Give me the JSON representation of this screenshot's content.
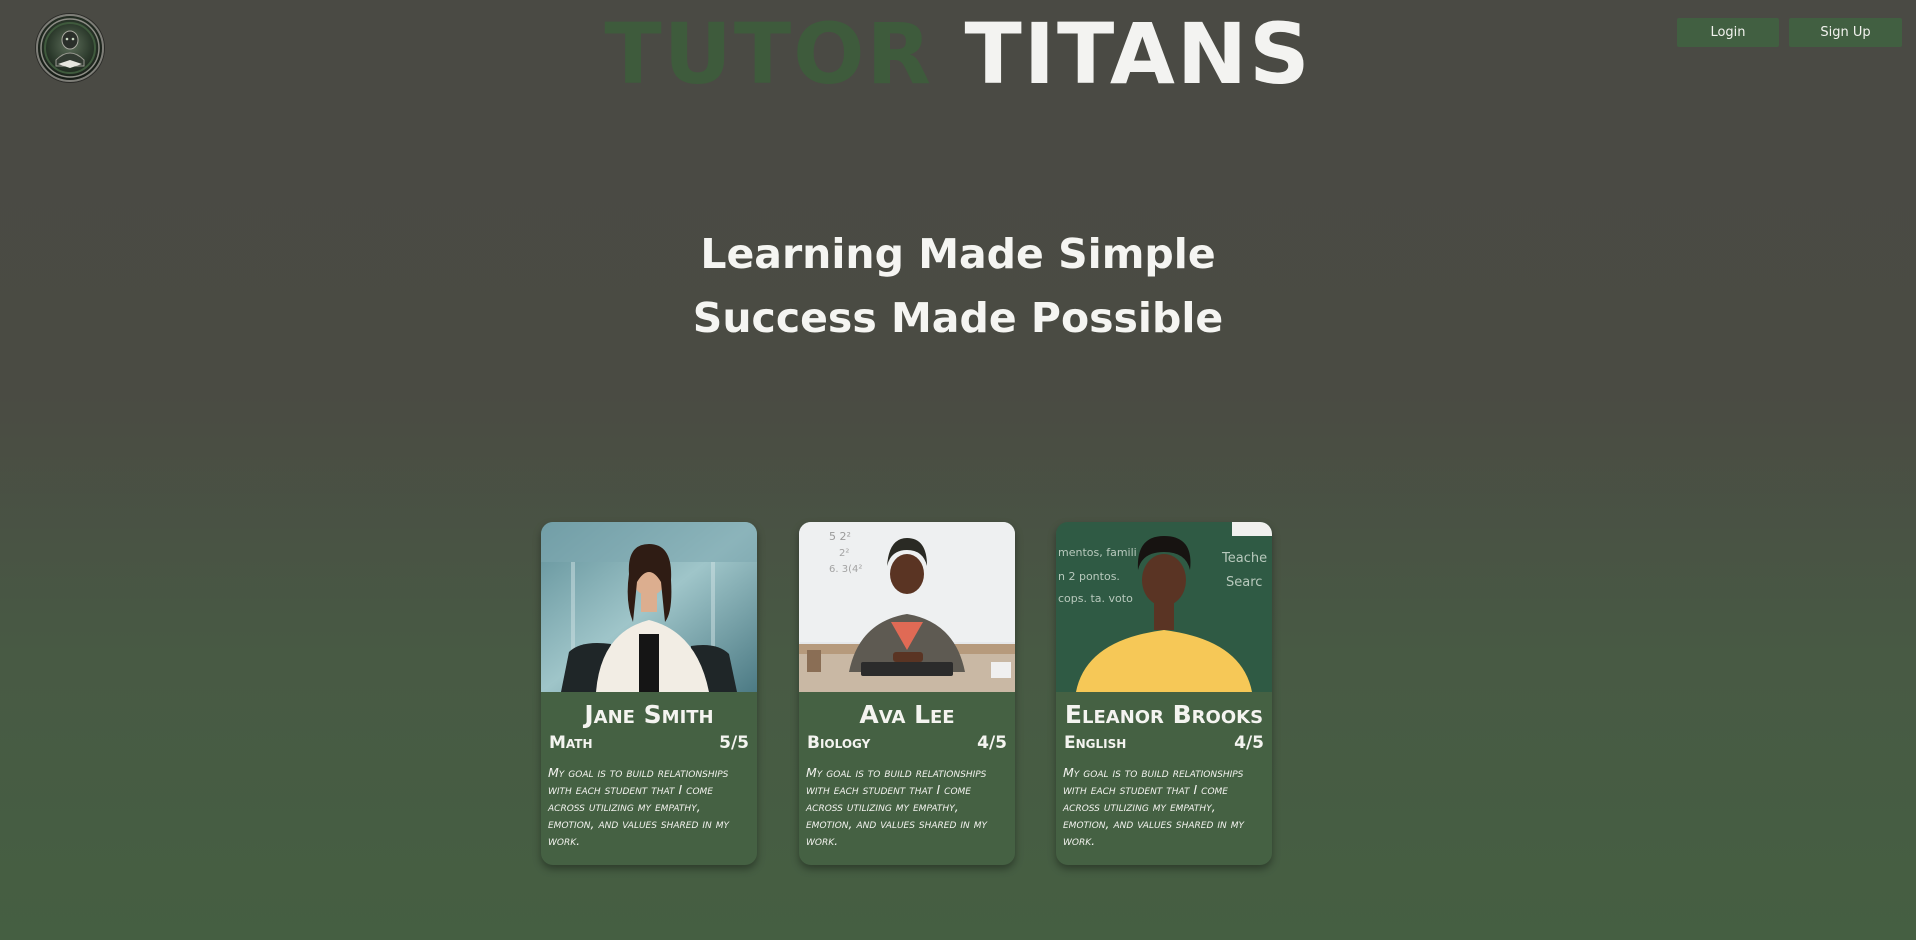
{
  "header": {
    "brand_first": "TUTOR",
    "brand_second": "TITANS",
    "login_label": "Login",
    "signup_label": "Sign Up"
  },
  "hero": {
    "line1": "Learning Made Simple",
    "line2": "Success Made Possible"
  },
  "tutors": [
    {
      "name": "Jane Smith",
      "subject": "Math",
      "rating": "5/5",
      "bio": "My goal is to build relationships with each student that I come across utilizing my empathy, emotion, and values shared in my work."
    },
    {
      "name": "Ava Lee",
      "subject": "Biology",
      "rating": "4/5",
      "bio": "My goal is to build relationships with each student that I come across utilizing my empathy, emotion, and values shared in my work."
    },
    {
      "name": "Eleanor Brooks",
      "subject": "English",
      "rating": "4/5",
      "bio": "My goal is to build relationships with each student that I come across utilizing my empathy, emotion, and values shared in my work."
    }
  ],
  "colors": {
    "brand_green": "#3e5b3c",
    "card_green": "#456143",
    "button_green": "#415f41",
    "text_light": "#f3f3f1"
  }
}
